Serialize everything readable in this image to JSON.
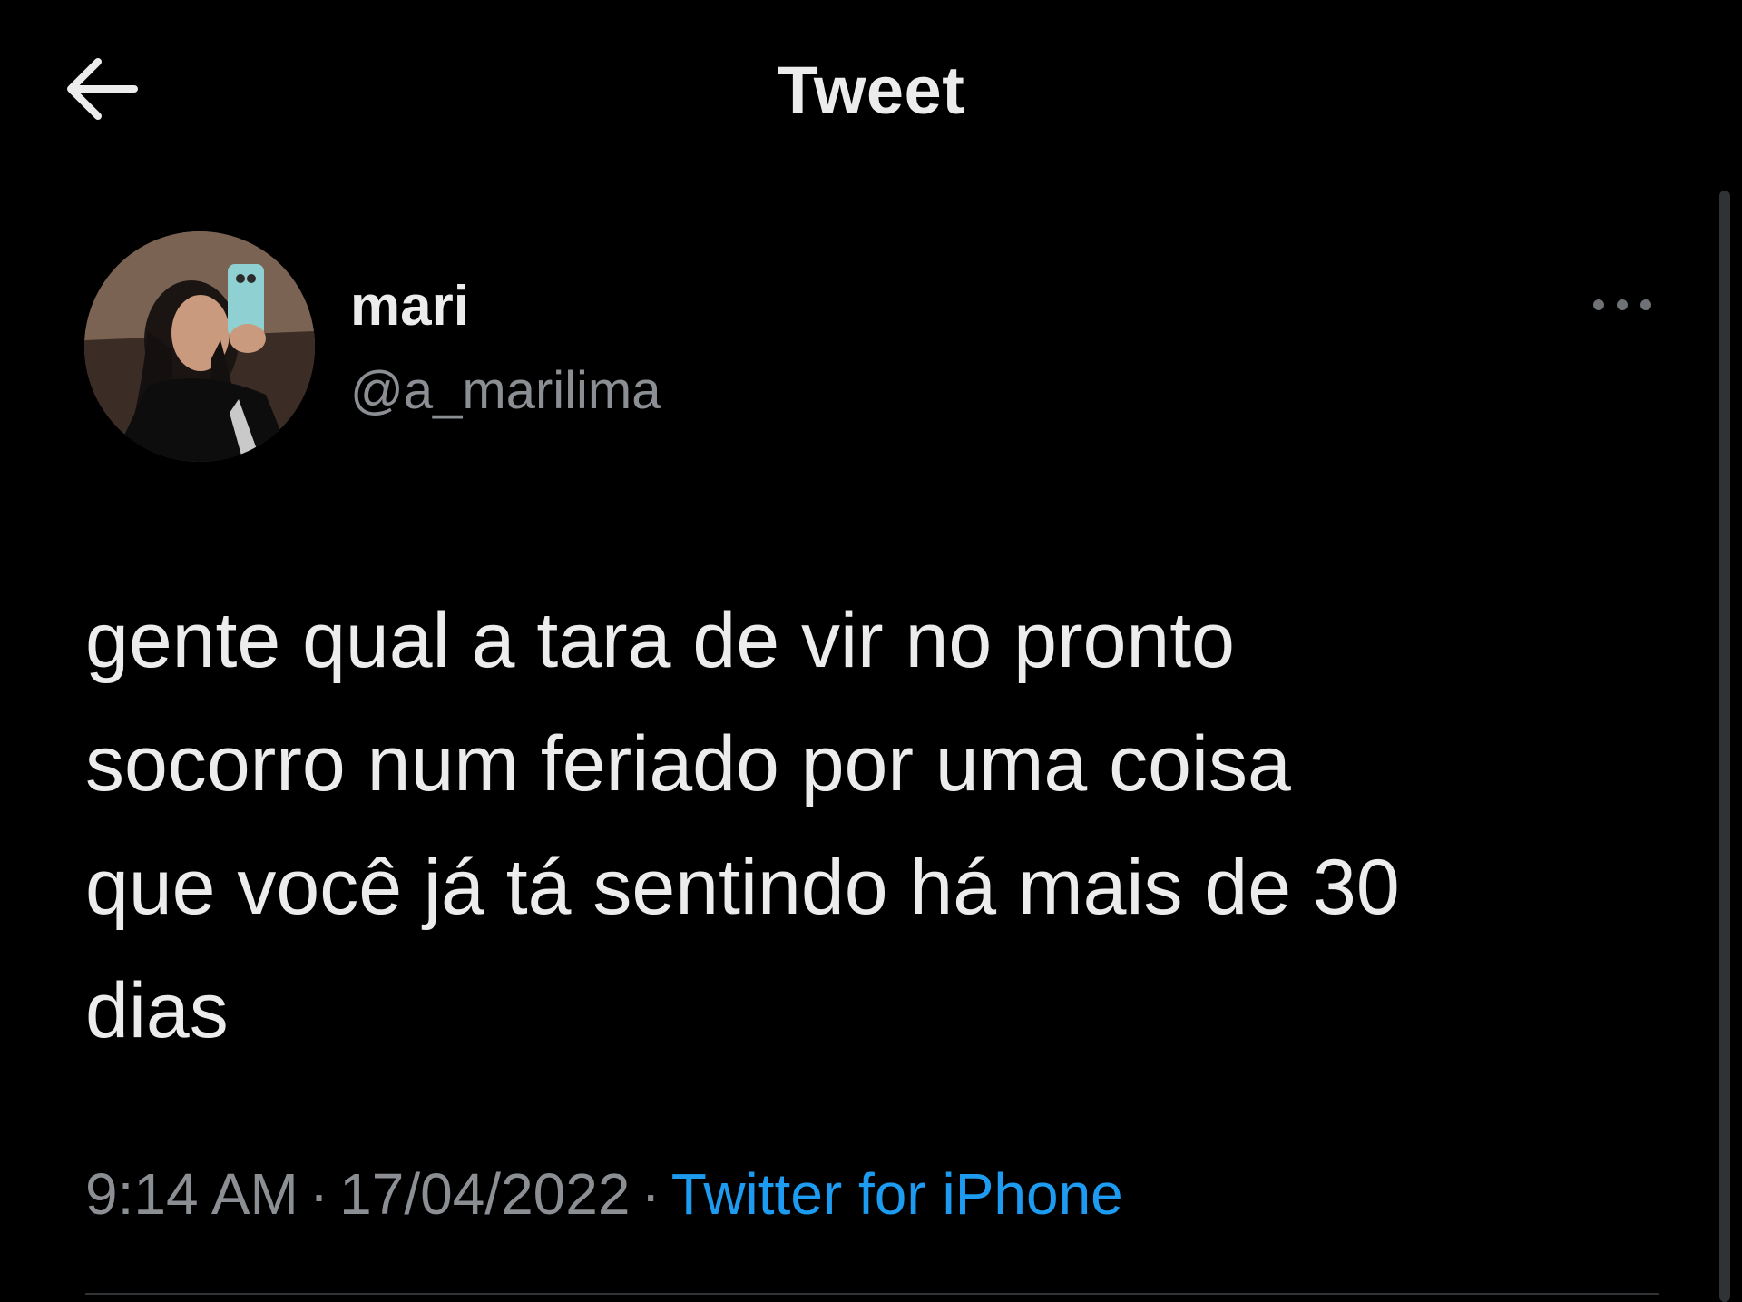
{
  "header": {
    "title": "Tweet",
    "back_icon": "arrow-left-icon"
  },
  "tweet": {
    "author": {
      "display_name": "mari",
      "handle": "@a_marilima",
      "avatar_icon": "profile-photo"
    },
    "more_icon": "more-dots-icon",
    "text_lines": [
      "gente qual a tara de vir no pronto",
      "socorro num feriado por uma coisa",
      "que você já tá sentindo há mais de 30",
      "dias"
    ],
    "meta": {
      "time": "9:14 AM",
      "separator": "·",
      "date": "17/04/2022",
      "source": "Twitter for iPhone"
    }
  },
  "colors": {
    "background": "#000000",
    "primary_text": "#ececec",
    "secondary_text": "#8b8f93",
    "link": "#1d9bf0",
    "divider": "#2f3336"
  }
}
